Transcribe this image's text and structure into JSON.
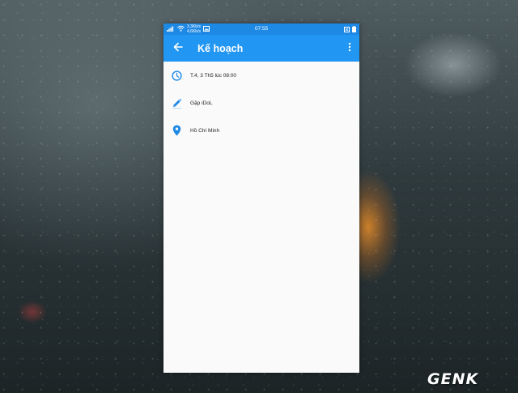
{
  "status_bar": {
    "net_speed_up": "3,3Kb/s",
    "net_speed_down": "4,6Kb/s",
    "time": "07:55"
  },
  "app_bar": {
    "title": "Kế hoạch",
    "back_icon": "arrow-back-icon",
    "menu_icon": "more-vert-icon"
  },
  "plan": {
    "items": [
      {
        "icon": "clock-icon",
        "text": "T.4, 3 Th5 lúc 08:00"
      },
      {
        "icon": "pencil-icon",
        "text": "Gặp iDoL"
      },
      {
        "icon": "location-pin-icon",
        "text": "Hồ Chí Minh"
      }
    ]
  },
  "watermark": {
    "logo": "GENK"
  },
  "colors": {
    "primary": "#2196f3",
    "status_bar": "#1e88e5",
    "icon": "#1e88e5",
    "background": "#fafafa"
  }
}
